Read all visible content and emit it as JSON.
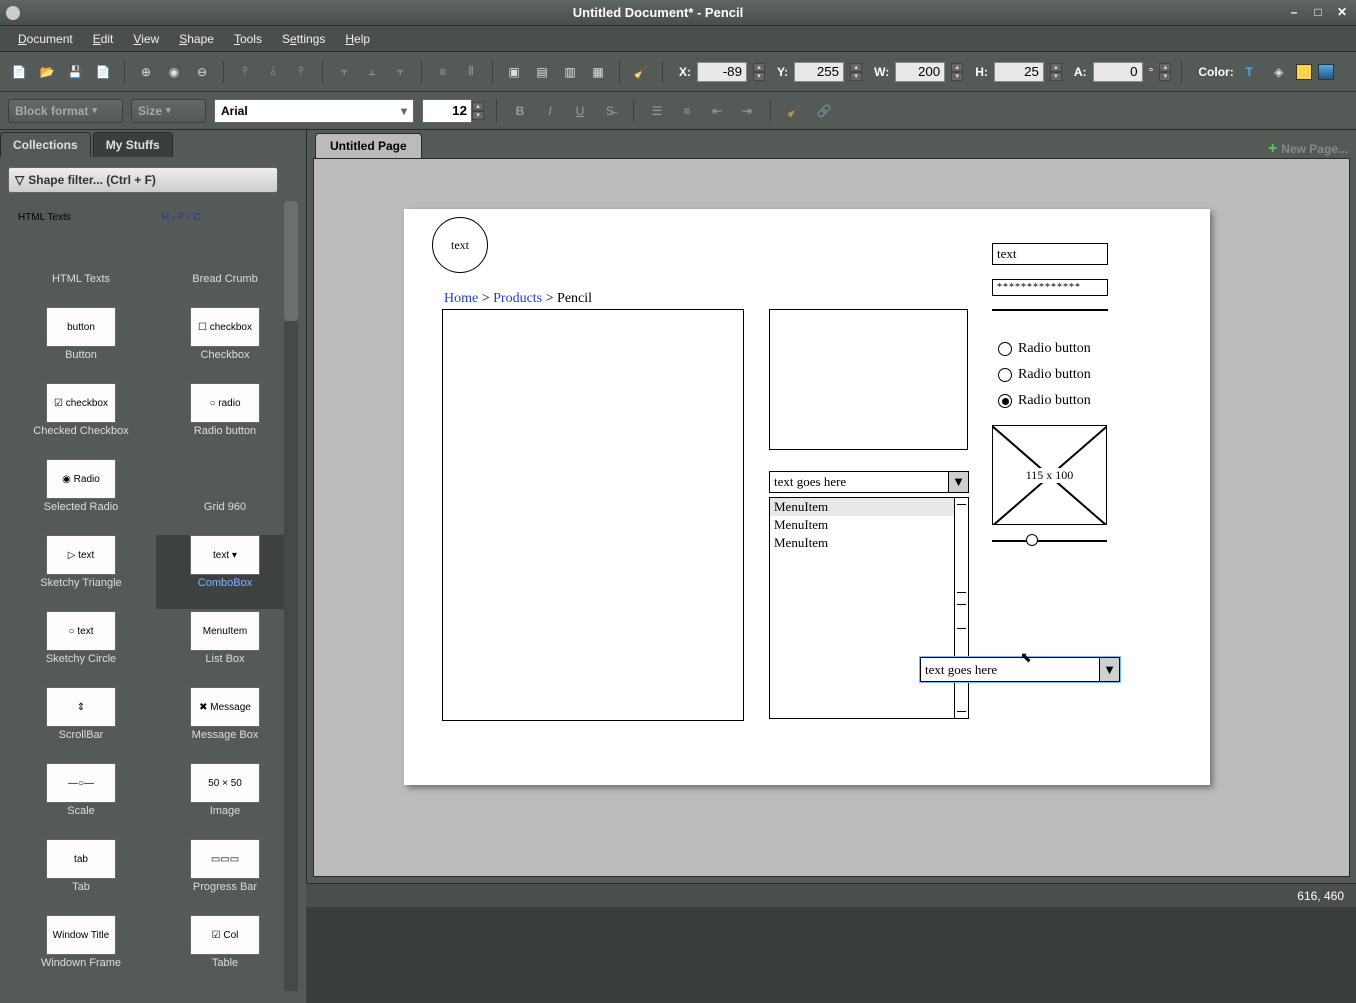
{
  "window": {
    "title": "Untitled Document* - Pencil"
  },
  "menu": {
    "items": [
      "Document",
      "Edit",
      "View",
      "Shape",
      "Tools",
      "Settings",
      "Help"
    ]
  },
  "props": {
    "x_label": "X:",
    "x": "-89",
    "y_label": "Y:",
    "y": "255",
    "w_label": "W:",
    "w": "200",
    "h_label": "H:",
    "h": "25",
    "a_label": "A:",
    "a": "0",
    "color_label": "Color:"
  },
  "toolbar2": {
    "blockformat": "Block format",
    "size": "Size",
    "font": "Arial",
    "fontsize": "12"
  },
  "side": {
    "tabs": {
      "collections": "Collections",
      "mystuffs": "My Stuffs"
    },
    "filter_placeholder": "Shape filter... (Ctrl + F)",
    "header_left": "HTML Texts",
    "header_right": "H › P › C",
    "shapes": [
      {
        "thumb": "",
        "label": "HTML Texts"
      },
      {
        "thumb": "",
        "label": "Bread Crumb"
      },
      {
        "thumb": "button",
        "label": "Button"
      },
      {
        "thumb": "☐ checkbox",
        "label": "Checkbox"
      },
      {
        "thumb": "☑ checkbox",
        "label": "Checked Checkbox"
      },
      {
        "thumb": "○ radio",
        "label": "Radio button"
      },
      {
        "thumb": "◉ Radio",
        "label": "Selected Radio"
      },
      {
        "thumb": "",
        "label": "Grid 960"
      },
      {
        "thumb": "▷ text",
        "label": "Sketchy Triangle"
      },
      {
        "thumb": "text ▾",
        "label": "ComboBox"
      },
      {
        "thumb": "○ text",
        "label": "Sketchy Circle"
      },
      {
        "thumb": "MenuItem",
        "label": "List Box"
      },
      {
        "thumb": "⇕",
        "label": "ScrollBar"
      },
      {
        "thumb": "✖ Message",
        "label": "Message Box"
      },
      {
        "thumb": "—○—",
        "label": "Scale"
      },
      {
        "thumb": "50 × 50",
        "label": "Image"
      },
      {
        "thumb": "tab",
        "label": "Tab"
      },
      {
        "thumb": "▭▭▭",
        "label": "Progress Bar"
      },
      {
        "thumb": "Window Title",
        "label": "Windown Frame"
      },
      {
        "thumb": "☑ Col",
        "label": "Table"
      }
    ]
  },
  "pagetabs": {
    "page1": "Untitled Page",
    "newpage": "New Page..."
  },
  "canvas": {
    "circle_text": "text",
    "breadcrumb": {
      "home": "Home",
      "sep": " > ",
      "products": "Products",
      "current": "Pencil"
    },
    "text_input": "text",
    "password": "**************",
    "radio_label": "Radio button",
    "image_dim": "115 x 100",
    "combo_text": "text goes here",
    "combo2_text": "text goes here",
    "menuitem": "MenuItem"
  },
  "status": {
    "coords": "616, 460"
  }
}
